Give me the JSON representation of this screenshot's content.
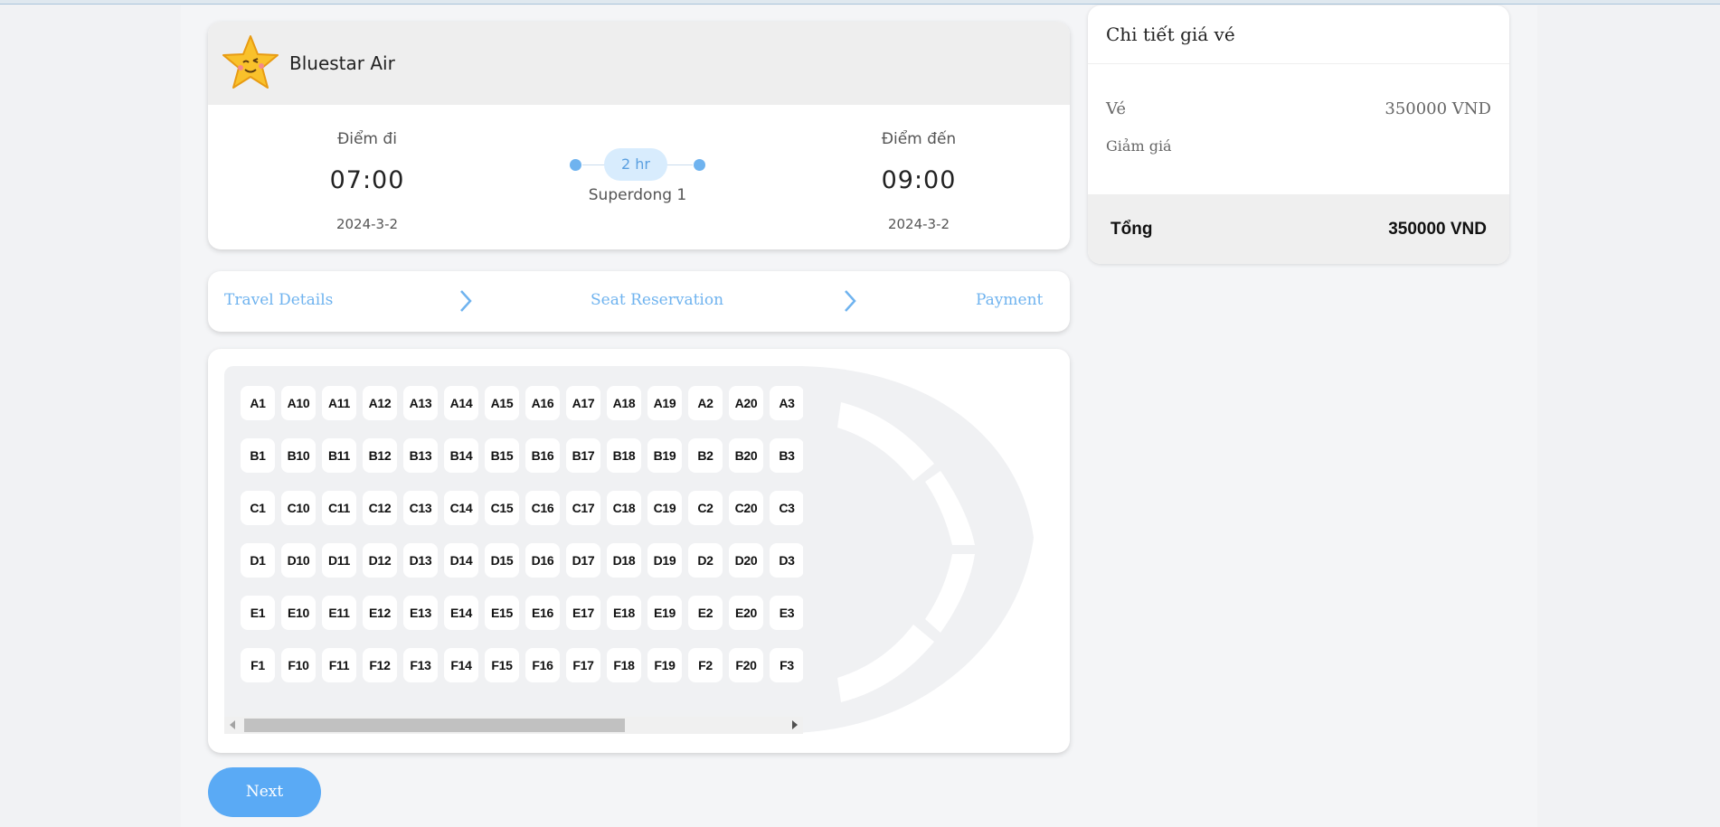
{
  "flight": {
    "airline": "Bluestar Air",
    "departure": {
      "label": "Điểm đi",
      "time": "07:00",
      "date": "2024-3-2"
    },
    "arrival": {
      "label": "Điểm đến",
      "time": "09:00",
      "date": "2024-3-2"
    },
    "duration": "2 hr",
    "vessel": "Superdong 1"
  },
  "steps": [
    "Travel Details",
    "Seat Reservation",
    "Payment"
  ],
  "seat_rows": [
    [
      "A1",
      "A10",
      "A11",
      "A12",
      "A13",
      "A14",
      "A15",
      "A16",
      "A17",
      "A18",
      "A19",
      "A2",
      "A20",
      "A3"
    ],
    [
      "B1",
      "B10",
      "B11",
      "B12",
      "B13",
      "B14",
      "B15",
      "B16",
      "B17",
      "B18",
      "B19",
      "B2",
      "B20",
      "B3"
    ],
    [
      "C1",
      "C10",
      "C11",
      "C12",
      "C13",
      "C14",
      "C15",
      "C16",
      "C17",
      "C18",
      "C19",
      "C2",
      "C20",
      "C3"
    ],
    [
      "D1",
      "D10",
      "D11",
      "D12",
      "D13",
      "D14",
      "D15",
      "D16",
      "D17",
      "D18",
      "D19",
      "D2",
      "D20",
      "D3"
    ],
    [
      "E1",
      "E10",
      "E11",
      "E12",
      "E13",
      "E14",
      "E15",
      "E16",
      "E17",
      "E18",
      "E19",
      "E2",
      "E20",
      "E3"
    ],
    [
      "F1",
      "F10",
      "F11",
      "F12",
      "F13",
      "F14",
      "F15",
      "F16",
      "F17",
      "F18",
      "F19",
      "F2",
      "F20",
      "F3"
    ]
  ],
  "next_label": "Next",
  "price": {
    "title": "Chi tiết giá vé",
    "ticket_label": "Vé",
    "ticket_value": "350000 VND",
    "discount_label": "Giảm giá",
    "total_label": "Tổng",
    "total_value": "350000 VND"
  },
  "colors": {
    "accent": "#5aaaf5",
    "steps_text": "#6fb3ef"
  }
}
